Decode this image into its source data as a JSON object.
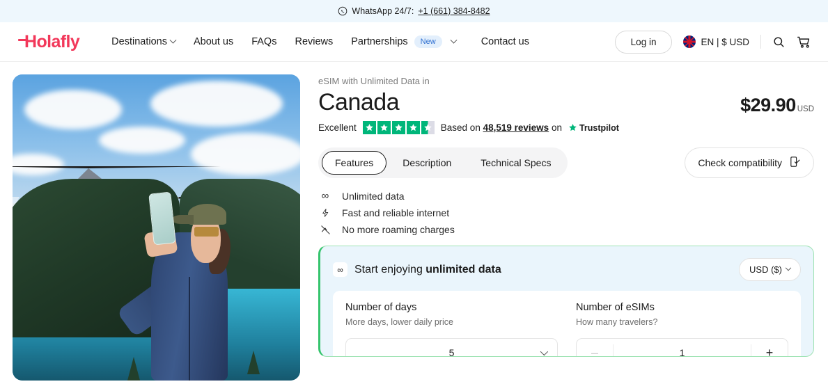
{
  "topbar": {
    "icon": "whatsapp-icon",
    "text": "WhatsApp 24/7:",
    "phone": "+1 (661) 384-8482"
  },
  "nav": {
    "logo": "Holafly",
    "links": [
      {
        "label": "Destinations",
        "caret": true
      },
      {
        "label": "About us",
        "caret": false
      },
      {
        "label": "FAQs",
        "caret": false
      },
      {
        "label": "Reviews",
        "caret": false
      },
      {
        "label": "Partnerships",
        "badge": "New",
        "caret": true
      },
      {
        "label": "Contact us",
        "caret": false
      }
    ],
    "login_label": "Log in",
    "locale": "EN | $ USD",
    "search_icon": "search-icon",
    "cart_icon": "cart-icon"
  },
  "product": {
    "eyebrow": "eSIM with Unlimited Data in",
    "title": "Canada",
    "price": "$29.90",
    "currency": "USD"
  },
  "trustpilot": {
    "rating_label": "Excellent",
    "stars": 4.5,
    "based_on": "Based on",
    "reviews": "48,519 reviews",
    "on": "on",
    "brand": "Trustpilot",
    "star_color": "#00b67a"
  },
  "tabs": [
    {
      "label": "Features",
      "active": true
    },
    {
      "label": "Description",
      "active": false
    },
    {
      "label": "Technical Specs",
      "active": false
    }
  ],
  "compatibility": {
    "label": "Check compatibility",
    "icon": "phone-check-icon"
  },
  "features": [
    {
      "icon": "infinity-icon",
      "label": "Unlimited data"
    },
    {
      "icon": "lightning-icon",
      "label": "Fast and reliable internet"
    },
    {
      "icon": "no-roaming-icon",
      "label": "No more roaming charges"
    }
  ],
  "plan": {
    "icon": "infinity-icon",
    "heading_prefix": "Start enjoying ",
    "heading_strong": "unlimited data",
    "currency_selector": "USD ($)",
    "accent_color": "#35c46d",
    "background_color": "#eaf5fc",
    "days": {
      "title": "Number of days",
      "subtitle": "More days, lower daily price",
      "value": "5"
    },
    "esims": {
      "title": "Number of eSIMs",
      "subtitle": "How many travelers?",
      "value": "1",
      "minus": "–",
      "plus": "+"
    }
  },
  "hero": {
    "alt": "Woman taking a photo with a phone at Peyto Lake in the Canadian Rockies"
  }
}
